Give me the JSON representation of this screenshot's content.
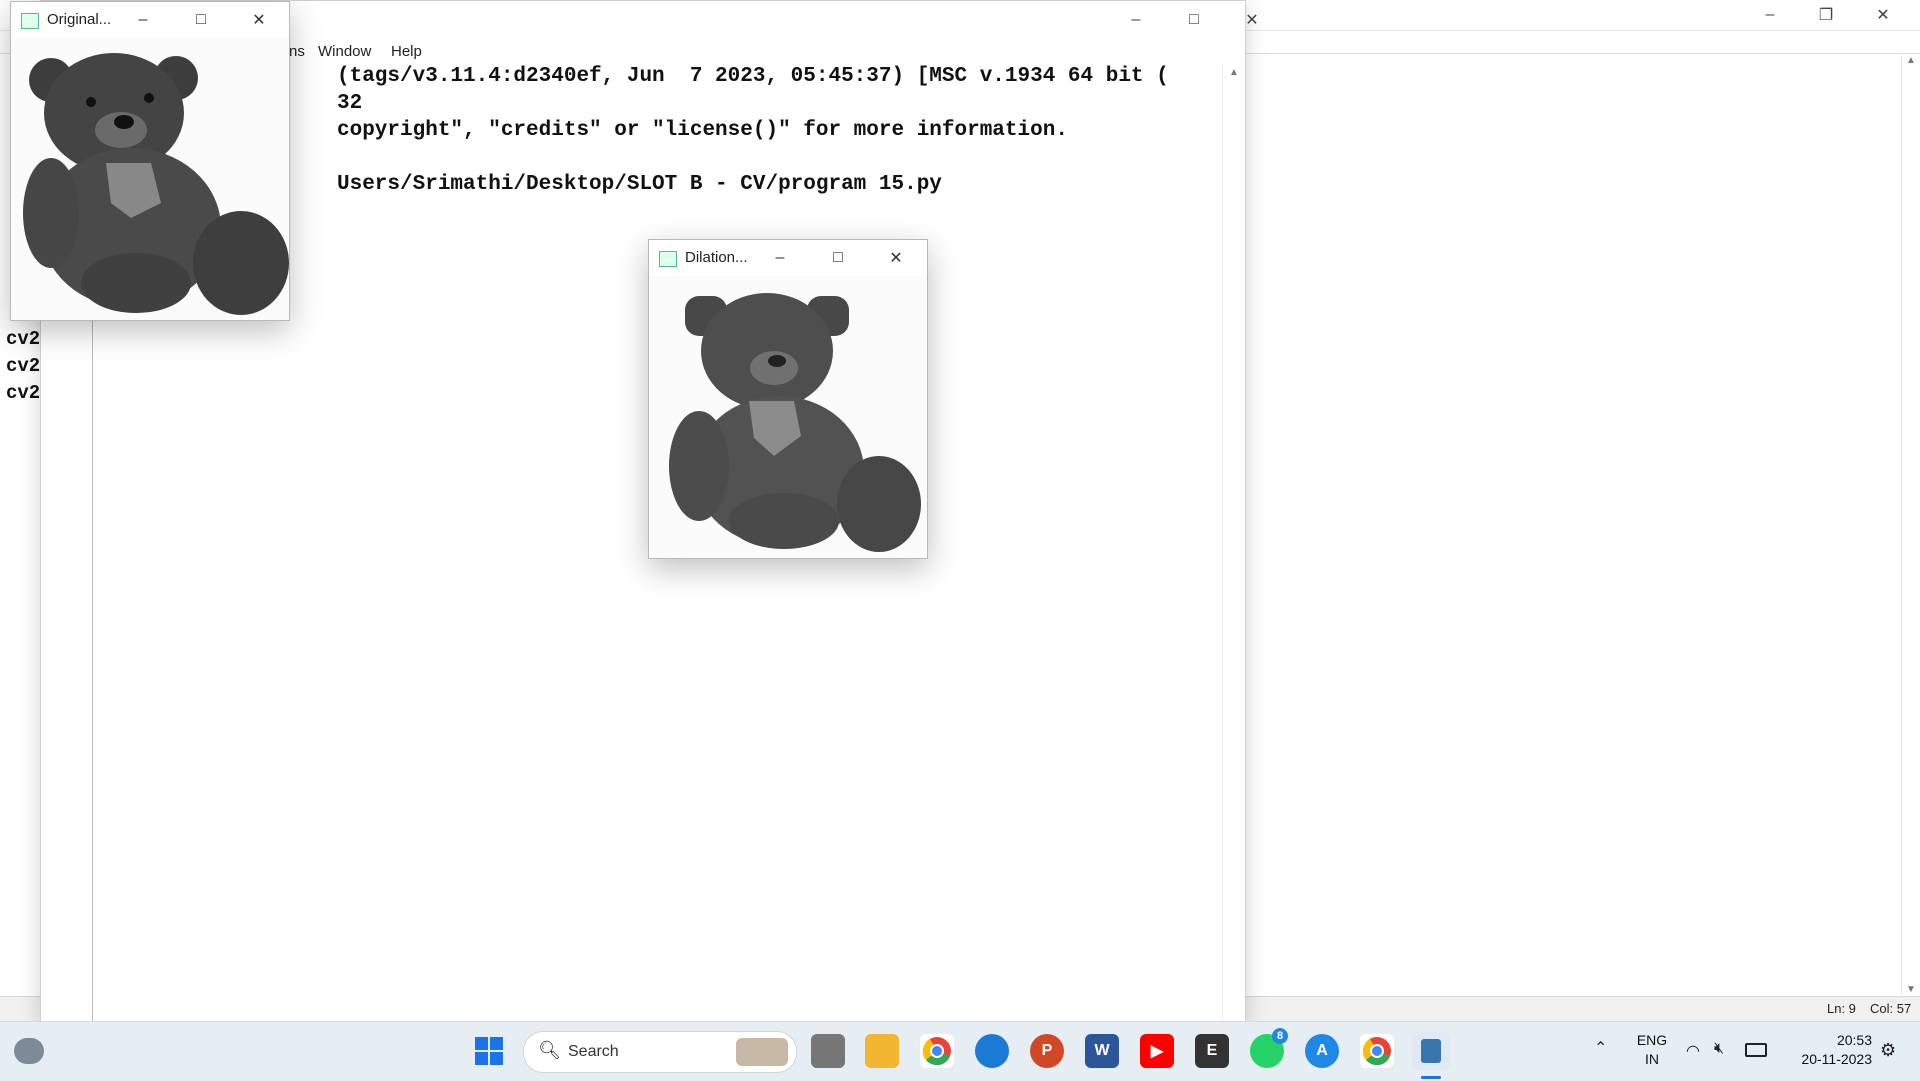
{
  "background_editor": {
    "status": {
      "line": "Ln: 9",
      "col": "Col: 57"
    },
    "visible_code_fragments": [
      "cv2",
      "cv2",
      "cv2"
    ]
  },
  "shell": {
    "menu": [
      "ns",
      "Window",
      "Help"
    ],
    "lines": [
      "(tags/v3.11.4:d2340ef, Jun  7 2023, 05:45:37) [MSC v.1934 64 bit (",
      "32",
      "copyright\", \"credits\" or \"license()\" for more information.",
      "",
      "Users/Srimathi/Desktop/SLOT B - CV/program 15.py"
    ]
  },
  "windows": {
    "original": {
      "title": "Original..."
    },
    "dilation": {
      "title": "Dilation..."
    }
  },
  "taskbar": {
    "search_label": "Search",
    "apps": [
      {
        "name": "windows-start",
        "color": "#1a73e8"
      },
      {
        "name": "task-view",
        "color": "#555555"
      },
      {
        "name": "file-explorer",
        "color": "#f2b632"
      },
      {
        "name": "chrome",
        "color": "#34a853"
      },
      {
        "name": "edge",
        "color": "#1b7bd4"
      },
      {
        "name": "powerpoint",
        "color": "#d24726"
      },
      {
        "name": "word",
        "color": "#2b579a"
      },
      {
        "name": "youtube",
        "color": "#ff0000"
      },
      {
        "name": "epic",
        "color": "#333333"
      },
      {
        "name": "whatsapp",
        "color": "#25d366"
      },
      {
        "name": "app-store",
        "color": "#1e88e5"
      },
      {
        "name": "chrome-2",
        "color": "#ea4335"
      },
      {
        "name": "python-idle",
        "color": "#3776ab"
      }
    ],
    "whatsapp_badge": "8",
    "tray": {
      "lang_top": "ENG",
      "lang_bottom": "IN",
      "time": "20:53",
      "date": "20-11-2023"
    }
  }
}
